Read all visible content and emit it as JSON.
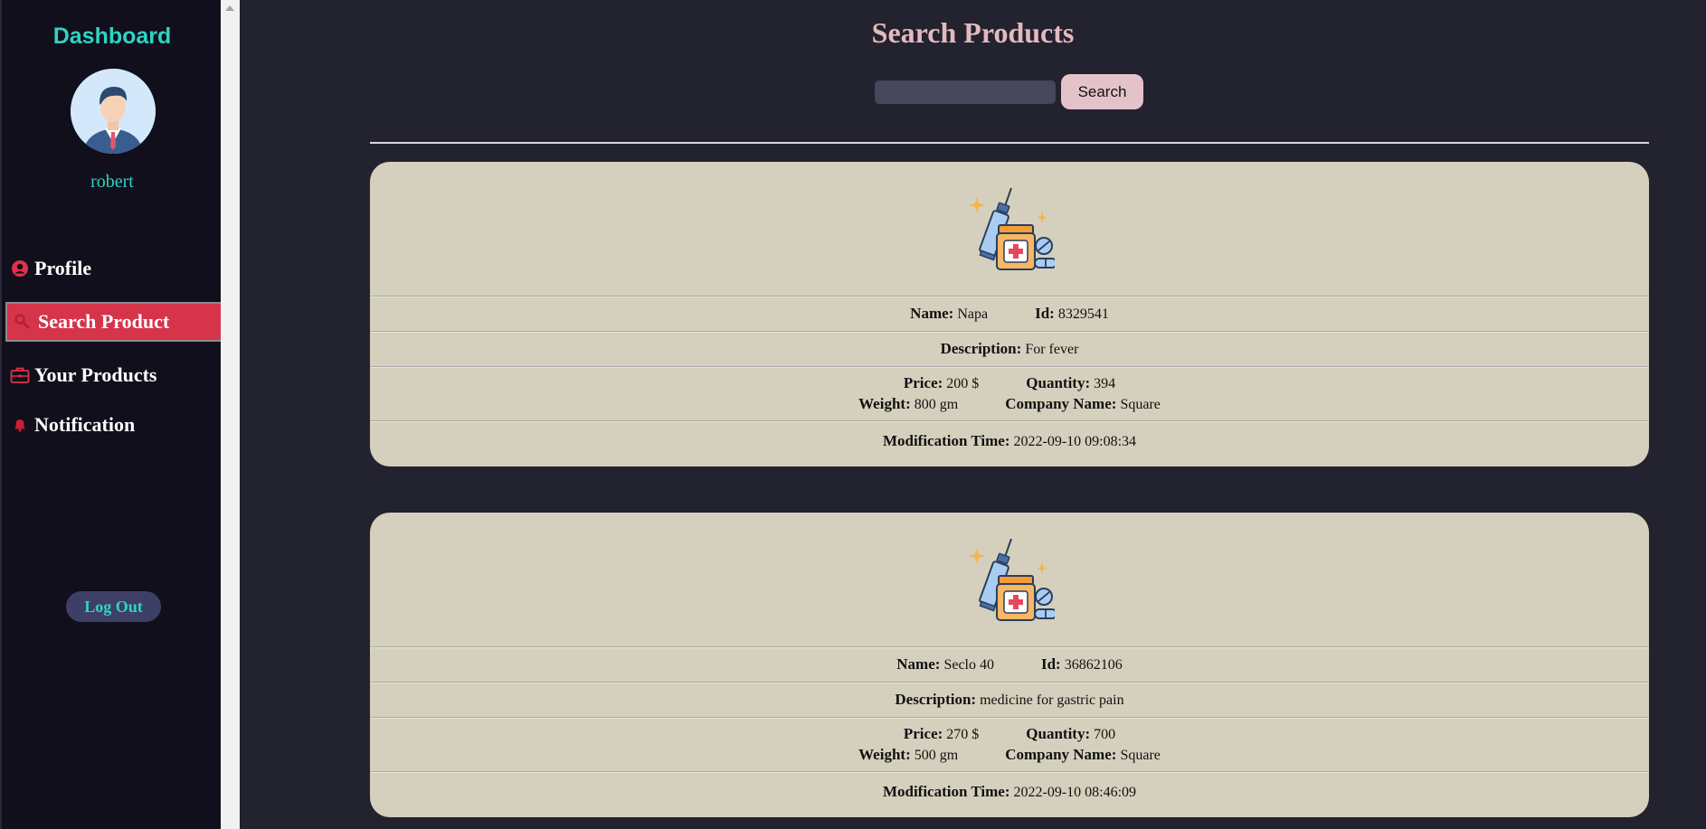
{
  "sidebar": {
    "title": "Dashboard",
    "username": "robert",
    "items": [
      {
        "label": "Profile",
        "icon": "user-circle-icon"
      },
      {
        "label": "Search Product",
        "icon": "search-icon",
        "active": true
      },
      {
        "label": "Your Products",
        "icon": "briefcase-icon"
      },
      {
        "label": "Notification",
        "icon": "bell-icon"
      }
    ],
    "logout_label": "Log Out"
  },
  "main": {
    "title": "Search Products",
    "search": {
      "placeholder": "",
      "value": "",
      "button_label": "Search"
    },
    "labels": {
      "name": "Name:",
      "id": "Id:",
      "description": "Description:",
      "price": "Price:",
      "quantity": "Quantity:",
      "weight": "Weight:",
      "company": "Company Name:",
      "modified": "Modification Time:"
    },
    "products": [
      {
        "name": "Napa",
        "id": "8329541",
        "description": "For fever",
        "price": "200 $",
        "quantity": "394",
        "weight": "800 gm",
        "company": "Square",
        "modified": "2022-09-10 09:08:34"
      },
      {
        "name": "Seclo 40",
        "id": "36862106",
        "description": "medicine for gastric pain",
        "price": "270 $",
        "quantity": "700",
        "weight": "500 gm",
        "company": "Square",
        "modified": "2022-09-10 08:46:09"
      }
    ]
  },
  "colors": {
    "accent_teal": "#2fd3c4",
    "active_red": "#d5344b",
    "title_pink": "#e3b9bf",
    "card_bg": "#d5d0bd"
  }
}
